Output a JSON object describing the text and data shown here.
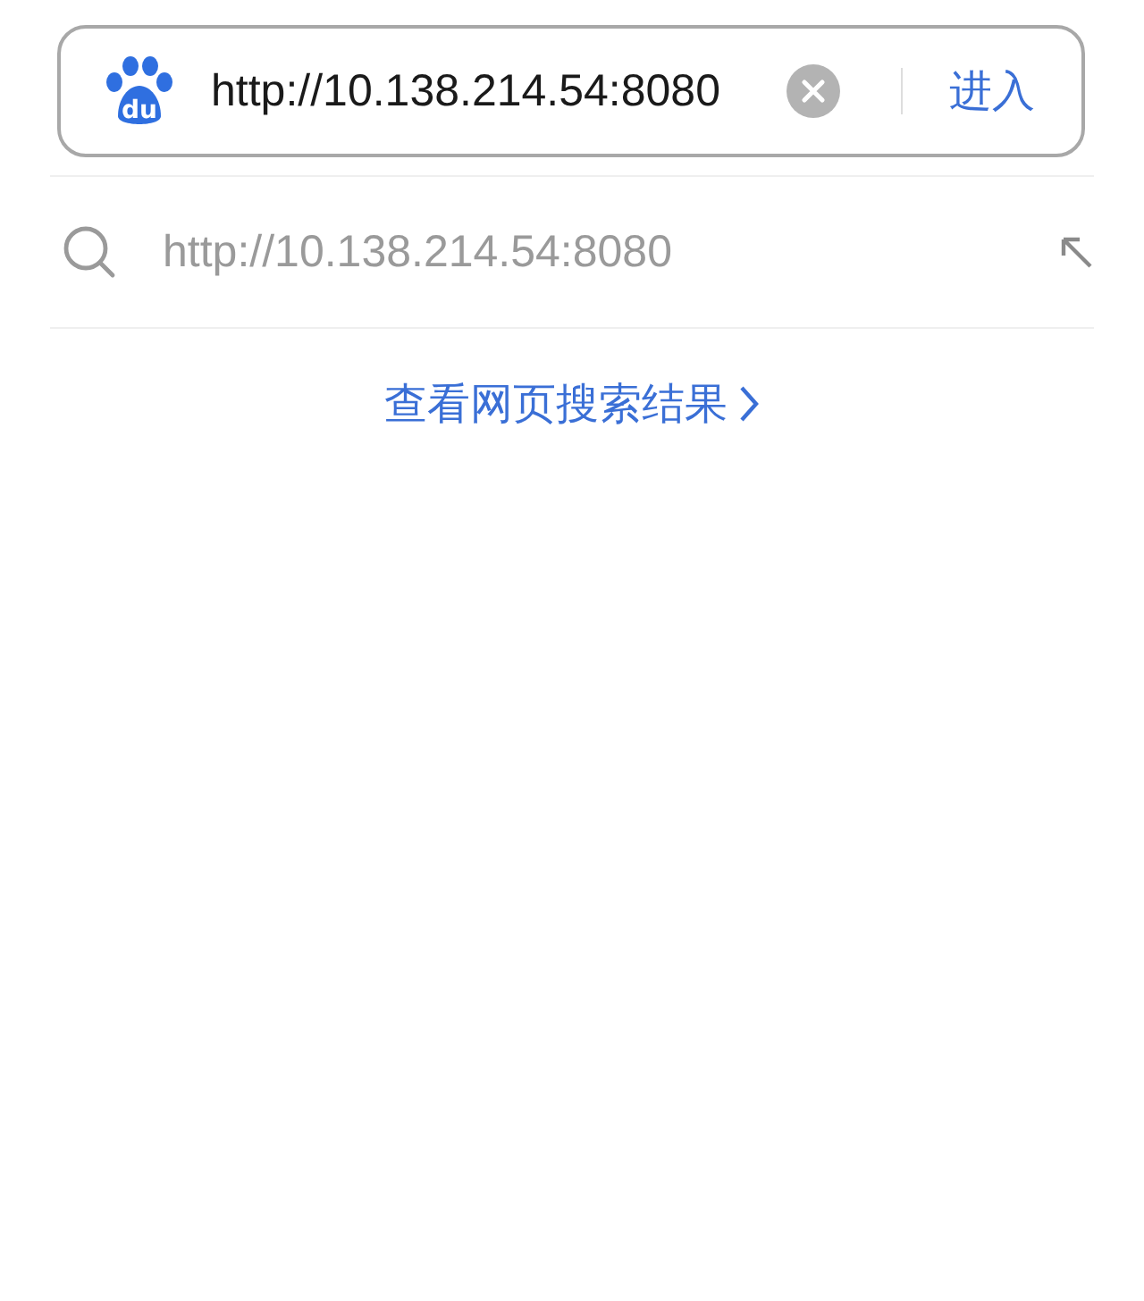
{
  "search_bar": {
    "logo_text": "du",
    "value": "http://10.138.214.54:8080",
    "submit": "进入"
  },
  "suggestions": [
    {
      "text": "http://10.138.214.54:8080"
    }
  ],
  "web_results_link": "查看网页搜索结果"
}
